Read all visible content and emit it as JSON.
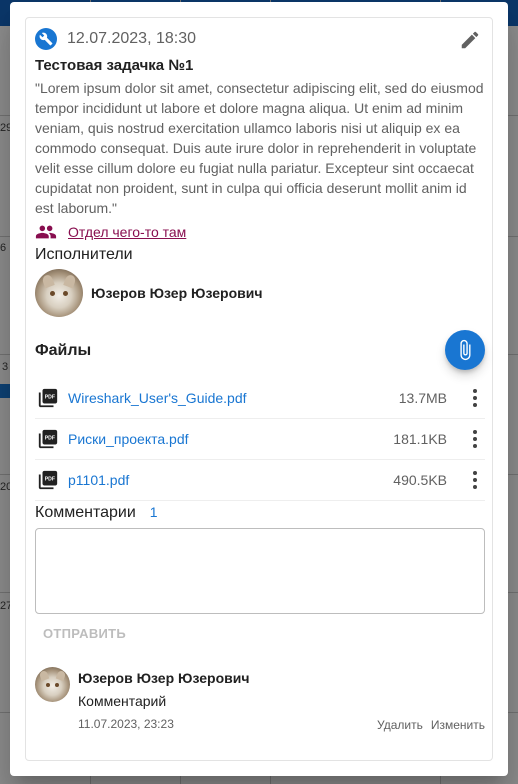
{
  "background": {
    "day_numbers": [
      "29",
      "6",
      "3",
      "20",
      "27"
    ]
  },
  "task": {
    "datetime": "12.07.2023, 18:30",
    "title": "Тестовая задачка №1",
    "description": "\"Lorem ipsum dolor sit amet, consectetur adipiscing elit, sed do eiusmod tempor incididunt ut labore et dolore magna aliqua. Ut enim ad minim veniam, quis nostrud exercitation ullamco laboris nisi ut aliquip ex ea commodo consequat. Duis aute irure dolor in reprehenderit in voluptate velit esse cillum dolore eu fugiat nulla pariatur. Excepteur sint occaecat cupidatat non proident, sunt in culpa qui officia deserunt mollit anim id est laborum.\"",
    "department": "Отдел чего-то там"
  },
  "executors": {
    "label": "Исполнители",
    "items": [
      {
        "name": "Юзеров Юзер Юзерович"
      }
    ]
  },
  "files": {
    "label": "Файлы",
    "items": [
      {
        "name": "Wireshark_User's_Guide.pdf",
        "size": "13.7MB"
      },
      {
        "name": "Риски_проекта.pdf",
        "size": "181.1KB"
      },
      {
        "name": "p1101.pdf",
        "size": "490.5KB"
      }
    ]
  },
  "comments": {
    "label": "Комментарии",
    "count": "1",
    "input_placeholder": "",
    "send_label": "ОТПРАВИТЬ",
    "items": [
      {
        "author": "Юзеров Юзер Юзерович",
        "text": "Комментарий",
        "date": "11.07.2023, 23:23",
        "delete_label": "Удалить",
        "edit_label": "Изменить"
      }
    ]
  },
  "colors": {
    "accent": "#1976d2",
    "department_link": "#880e4f",
    "topbar": "#1565c0"
  },
  "icons": {
    "header": "wrench-icon",
    "edit": "pencil-icon",
    "department": "people-icon",
    "attach": "paperclip-icon",
    "file": "pdf-file-icon",
    "menu": "more-vertical-icon"
  }
}
